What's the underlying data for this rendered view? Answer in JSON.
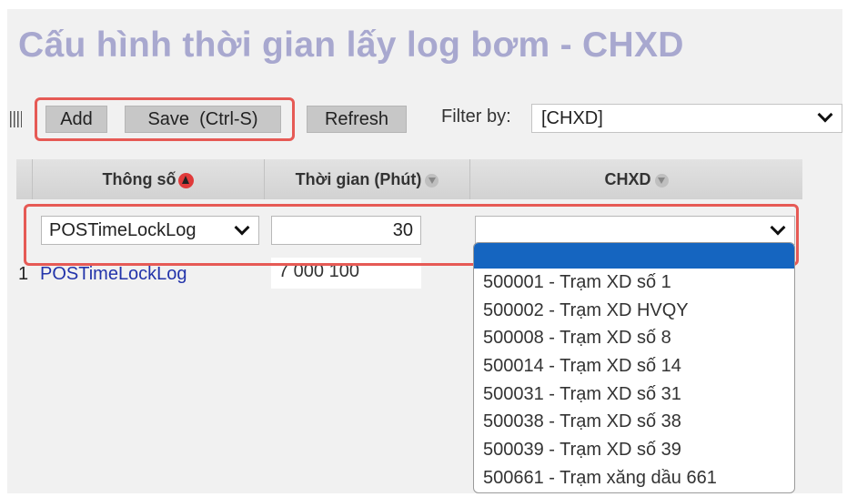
{
  "page": {
    "title": "Cấu hình thời gian lấy log bơm - CHXD"
  },
  "toolbar": {
    "add_label": "Add",
    "save_label": "Save  (Ctrl-S)",
    "refresh_label": "Refresh",
    "filter_label": "Filter by:",
    "filter_value": "[CHXD]"
  },
  "table": {
    "headers": [
      "Thông số",
      "Thời gian (Phút)",
      "CHXD"
    ],
    "edit_row": {
      "param": "POSTimeLockLog",
      "minutes": "30",
      "chxd": ""
    },
    "rows": [
      {
        "index": "1",
        "param": "POSTimeLockLog",
        "minutes": "7 000 100"
      }
    ]
  },
  "dropdown": {
    "options": [
      "500001 - Trạm XD số 1",
      "500002 - Trạm XD HVQY",
      "500008 - Trạm XD số 8",
      "500014 - Trạm XD số 14",
      "500031 - Trạm XD số 31",
      "500038 - Trạm XD số 38",
      "500039 - Trạm XD số 39",
      "500661 - Trạm xăng dầu 661"
    ]
  },
  "colors": {
    "title": "#a8a8cf",
    "highlight_box": "#e65a55",
    "selected_option": "#1565c0",
    "link": "#2233aa"
  }
}
